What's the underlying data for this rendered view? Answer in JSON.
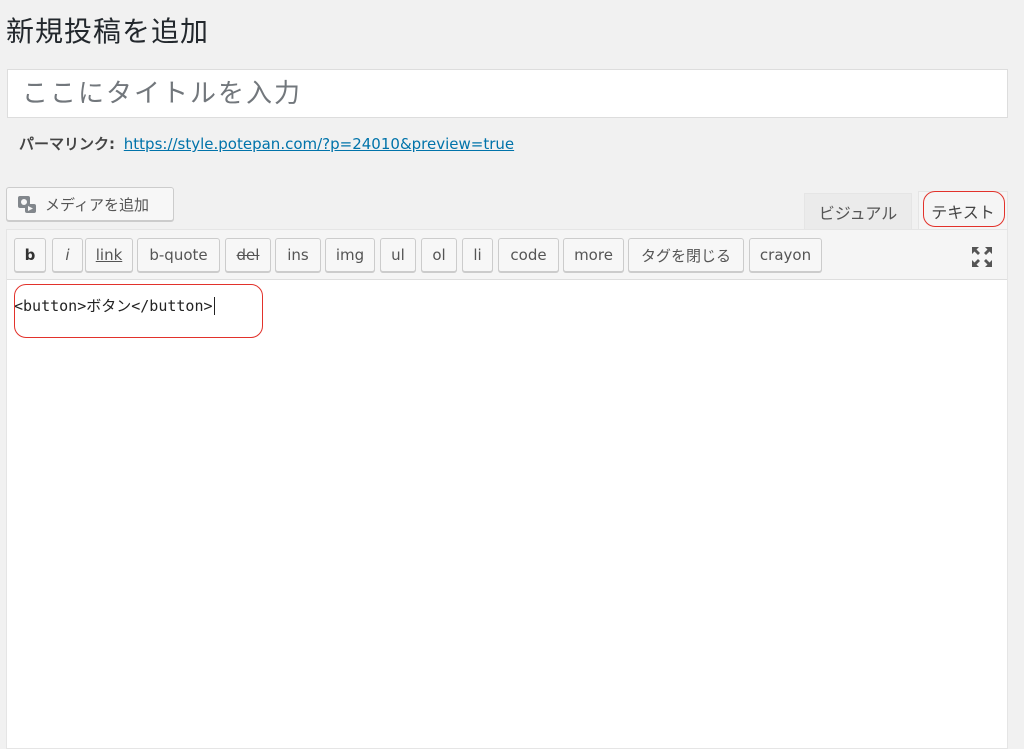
{
  "page": {
    "title": "新規投稿を追加"
  },
  "post_title": {
    "placeholder": "ここにタイトルを入力",
    "value": ""
  },
  "permalink": {
    "label": "パーマリンク:",
    "url": "https://style.potepan.com/?p=24010&preview=true"
  },
  "media": {
    "button_label": "メディアを追加",
    "icon": "media-add-icon"
  },
  "tabs": {
    "visual": "ビジュアル",
    "text": "テキスト",
    "active": "text"
  },
  "toolbar": {
    "buttons": [
      "b",
      "i",
      "link",
      "b-quote",
      "del",
      "ins",
      "img",
      "ul",
      "ol",
      "li",
      "code",
      "more",
      "タグを閉じる",
      "crayon"
    ],
    "fullscreen_icon": "fullscreen-icon"
  },
  "editor": {
    "content": "<button>ボタン</button>"
  },
  "colors": {
    "highlight": "#e2322b",
    "link": "#0073aa",
    "background": "#f1f1f1"
  }
}
